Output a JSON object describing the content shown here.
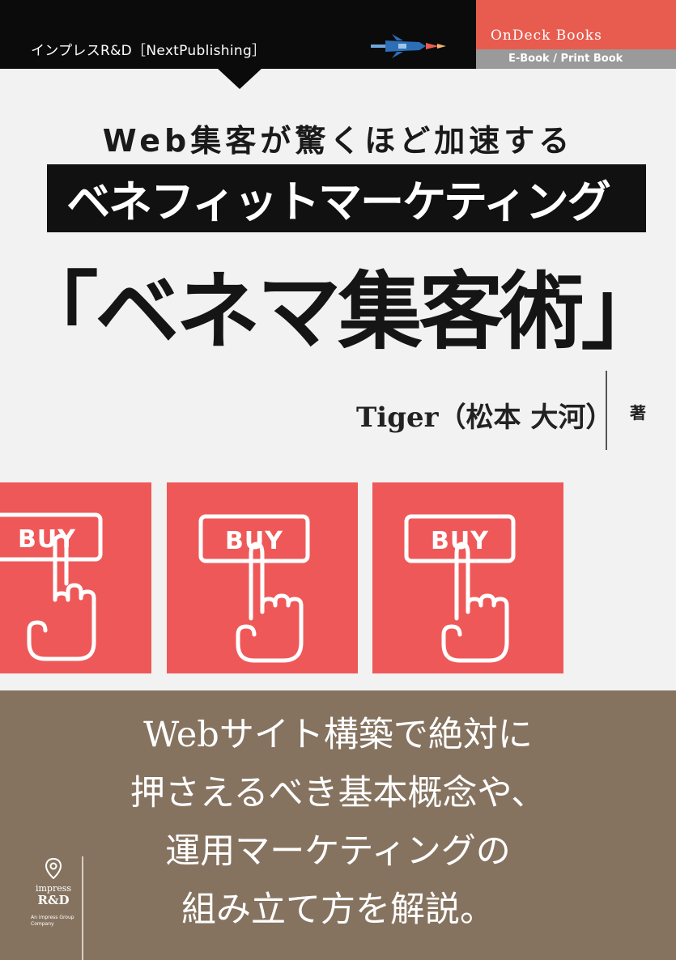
{
  "header": {
    "publisher": "インプレスR&D［NextPublishing］",
    "ondeck_brand": "OnDeck Books",
    "ondeck_format": "E-Book / Print Book"
  },
  "title": {
    "subtitle": "Web集客が驚くほど加速する",
    "bar": "ベネフィットマーケティング",
    "main": "「ベネマ集客術」"
  },
  "author": {
    "name": "Tiger（松本 大河）",
    "role": "著"
  },
  "tiles": [
    {
      "label": "BUY"
    },
    {
      "label": "BUY"
    },
    {
      "label": "BUY"
    }
  ],
  "tagline": {
    "lines": [
      "Webサイト構築で絶対に",
      "押さえるべき基本概念や、",
      "運用マーケティングの",
      "組み立て方を解説。"
    ]
  },
  "imprint": {
    "name": "impress",
    "rd": "R&D",
    "group": "An impress Group Company"
  },
  "colors": {
    "accent_red": "#ef5858",
    "ondeck_red": "#e85c4f",
    "brown": "#857360",
    "black": "#0b0b0b"
  }
}
